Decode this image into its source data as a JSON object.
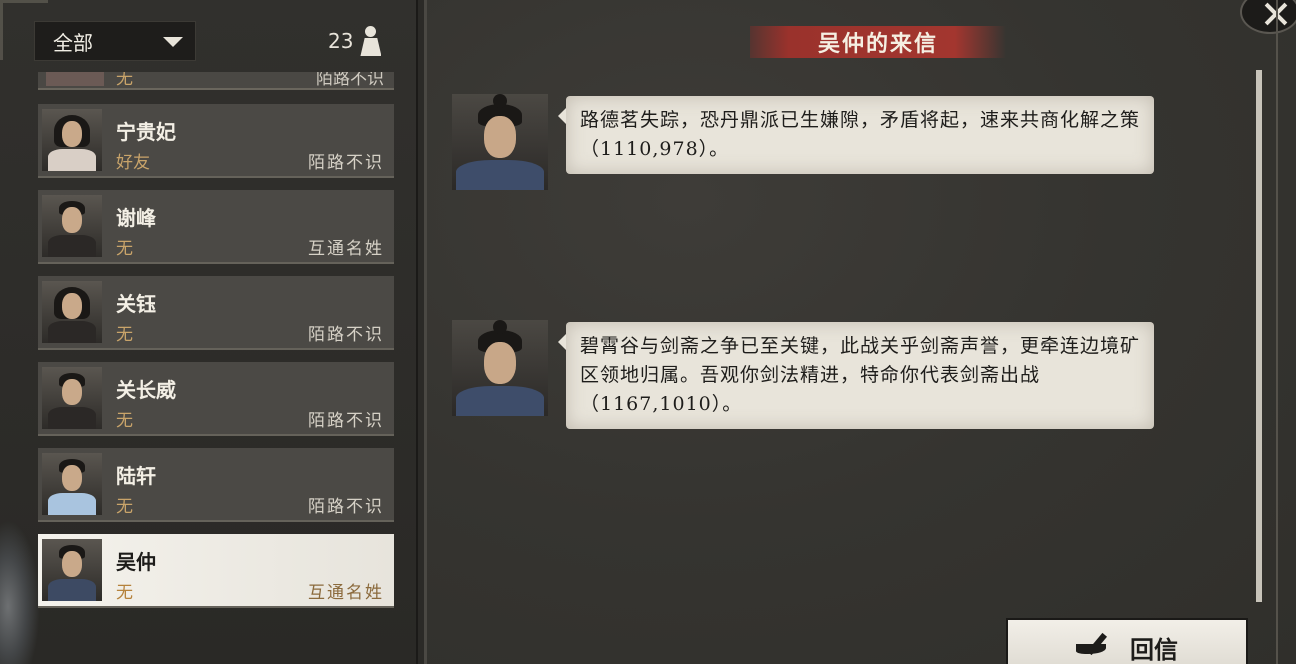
{
  "header": {
    "filter_label": "全部",
    "count": "23"
  },
  "contacts": [
    {
      "name": "",
      "relation": "无",
      "status": "陌路不识"
    },
    {
      "name": "宁贵妃",
      "relation": "好友",
      "status": "陌路不识"
    },
    {
      "name": "谢峰",
      "relation": "无",
      "status": "互通名姓"
    },
    {
      "name": "关钰",
      "relation": "无",
      "status": "陌路不识"
    },
    {
      "name": "关长威",
      "relation": "无",
      "status": "陌路不识"
    },
    {
      "name": "陆轩",
      "relation": "无",
      "status": "陌路不识"
    },
    {
      "name": "吴仲",
      "relation": "无",
      "status": "互通名姓"
    }
  ],
  "letter": {
    "title": "吴仲的来信",
    "messages": [
      {
        "text": "路德茗失踪，恐丹鼎派已生嫌隙，矛盾将起，速来共商化解之策（1110,978）。"
      },
      {
        "text": "碧霄谷与剑斋之争已至关键，此战关乎剑斋声誉，更牵连边境矿区领地归属。吾观你剑法精进，特命你代表剑斋出战（1167,1010）。"
      }
    ]
  },
  "reply_label": "回信"
}
